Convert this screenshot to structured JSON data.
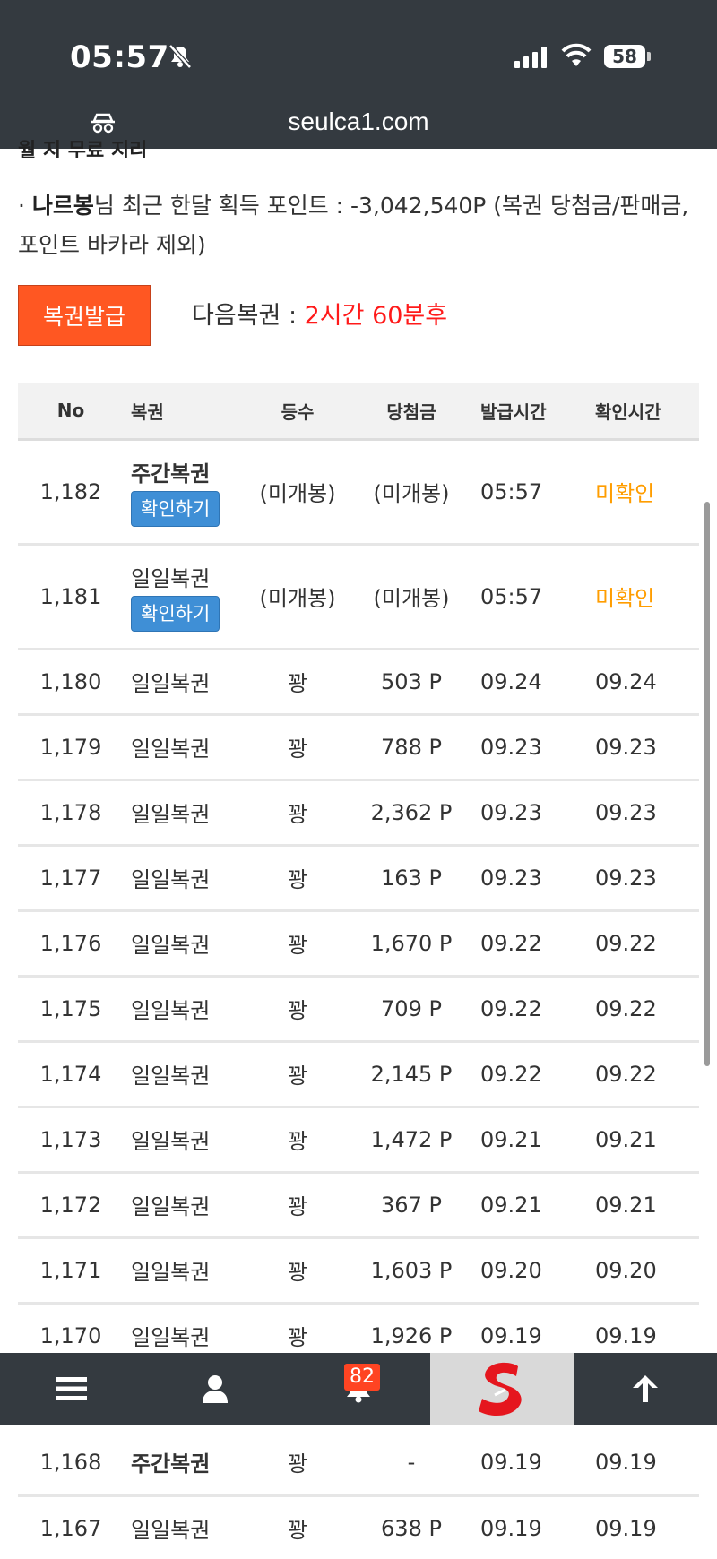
{
  "status_bar": {
    "time": "05:57",
    "battery": "58"
  },
  "browser": {
    "url": "seulca1.com"
  },
  "content": {
    "cut_line": "월 지 무료 지리",
    "points_user": "나르봉",
    "points_text": "님 최근 한달 획득 포인트 : -3,042,540P (복권 당첨금/판매금, 포인트 바카라 제외)",
    "issue_button": "복권발급",
    "next_label": "다음복권 : ",
    "next_value": "2시간 60분후"
  },
  "table": {
    "headers": {
      "no": "No",
      "type": "복권",
      "rank": "등수",
      "prize": "당첨금",
      "issued": "발급시간",
      "checked": "확인시간"
    },
    "check_button": "확인하기",
    "rows": [
      {
        "no": "1,182",
        "type": "주간복권",
        "rank": "(미개봉)",
        "prize": "(미개봉)",
        "issued": "05:57",
        "checked": "미확인"
      },
      {
        "no": "1,181",
        "type": "일일복권",
        "rank": "(미개봉)",
        "prize": "(미개봉)",
        "issued": "05:57",
        "checked": "미확인"
      },
      {
        "no": "1,180",
        "type": "일일복권",
        "rank": "꽝",
        "prize": "503 P",
        "issued": "09.24",
        "checked": "09.24"
      },
      {
        "no": "1,179",
        "type": "일일복권",
        "rank": "꽝",
        "prize": "788 P",
        "issued": "09.23",
        "checked": "09.23"
      },
      {
        "no": "1,178",
        "type": "일일복권",
        "rank": "꽝",
        "prize": "2,362 P",
        "issued": "09.23",
        "checked": "09.23"
      },
      {
        "no": "1,177",
        "type": "일일복권",
        "rank": "꽝",
        "prize": "163 P",
        "issued": "09.23",
        "checked": "09.23"
      },
      {
        "no": "1,176",
        "type": "일일복권",
        "rank": "꽝",
        "prize": "1,670 P",
        "issued": "09.22",
        "checked": "09.22"
      },
      {
        "no": "1,175",
        "type": "일일복권",
        "rank": "꽝",
        "prize": "709 P",
        "issued": "09.22",
        "checked": "09.22"
      },
      {
        "no": "1,174",
        "type": "일일복권",
        "rank": "꽝",
        "prize": "2,145 P",
        "issued": "09.22",
        "checked": "09.22"
      },
      {
        "no": "1,173",
        "type": "일일복권",
        "rank": "꽝",
        "prize": "1,472 P",
        "issued": "09.21",
        "checked": "09.21"
      },
      {
        "no": "1,172",
        "type": "일일복권",
        "rank": "꽝",
        "prize": "367 P",
        "issued": "09.21",
        "checked": "09.21"
      },
      {
        "no": "1,171",
        "type": "일일복권",
        "rank": "꽝",
        "prize": "1,603 P",
        "issued": "09.20",
        "checked": "09.20"
      },
      {
        "no": "1,170",
        "type": "일일복권",
        "rank": "꽝",
        "prize": "1,926 P",
        "issued": "09.19",
        "checked": "09.19"
      },
      {
        "no": "1,168",
        "type": "주간복권",
        "rank": "꽝",
        "prize": "-",
        "issued": "09.19",
        "checked": "09.19"
      },
      {
        "no": "1,167",
        "type": "일일복권",
        "rank": "꽝",
        "prize": "638 P",
        "issued": "09.19",
        "checked": "09.19"
      }
    ]
  },
  "bottom_nav": {
    "items": [
      "menu-icon",
      "user-icon",
      "bell-icon",
      "site-logo",
      "arrow-up-icon"
    ],
    "notification_count": "82"
  },
  "colors": {
    "dark": "#343a40",
    "issue_button": "#ff5722",
    "next_value": "#ff1a1a",
    "unchecked": "#ff9d00",
    "check_button": "#3f8fd6"
  }
}
